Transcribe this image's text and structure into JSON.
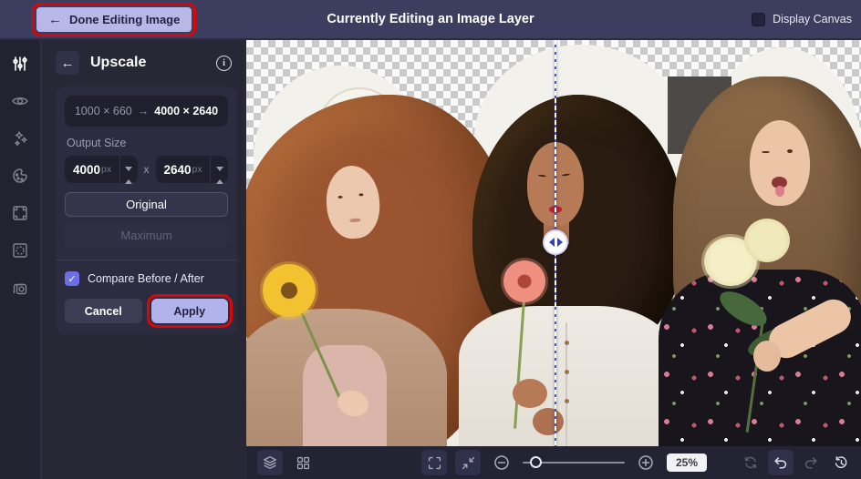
{
  "ui_colors": {
    "top_bar_bg": "#3d3d5f",
    "panel_bg": "#272736",
    "sidebar_bg": "#222231",
    "card_bg": "#2c2c40",
    "accent_lavender": "#b3b3ec",
    "checkbox_blue": "#6e6ee9",
    "annotation_red": "#dd0606",
    "zoom_pill_bg": "#f2f2f5"
  },
  "annotations": {
    "style": "red outline boxes",
    "highlighted_elements": [
      "done-editing-button",
      "apply-button"
    ]
  },
  "top_bar": {
    "back_arrow": "←",
    "done_button_label": "Done Editing Image",
    "title": "Currently Editing an Image Layer",
    "display_canvas_label": "Display Canvas",
    "display_canvas_checked": false
  },
  "sidebar": {
    "tools": [
      {
        "icon": "adjust-sliders-icon",
        "active": true
      },
      {
        "icon": "eye-icon",
        "active": false
      },
      {
        "icon": "magic-effects-icon",
        "active": false
      },
      {
        "icon": "color-palette-icon",
        "active": false
      },
      {
        "icon": "frame-icon",
        "active": false
      },
      {
        "icon": "mask-icon",
        "active": false
      },
      {
        "icon": "duplicate-layers-icon",
        "active": false
      }
    ]
  },
  "upscale_panel": {
    "back_arrow": "←",
    "title": "Upscale",
    "info_icon": "i",
    "dimension_before": "1000 × 660",
    "dimension_arrow": "→",
    "dimension_after": "4000 × 2640",
    "output_size_label": "Output Size",
    "width_value": "4000",
    "width_unit": "px",
    "size_separator": "x",
    "height_value": "2640",
    "height_unit": "px",
    "original_button_label": "Original",
    "maximum_button_label": "Maximum",
    "compare_checkbox": {
      "checked": true,
      "check_glyph": "✓",
      "label": "Compare Before / After"
    },
    "cancel_button_label": "Cancel",
    "apply_button_label": "Apply"
  },
  "canvas": {
    "content_description": "Three women holding flowers in front of white arches; background removed to transparency checkerboard at top; before/after upscale comparison divider down the middle",
    "divider": {
      "type": "before-after-drag-handle"
    },
    "zoom_level": "25%"
  },
  "toolbar_icons": [
    "layers-icon",
    "grid-view-icon",
    "fit-screen-icon",
    "collapse-view-icon",
    "zoom-out-icon",
    "zoom-slider",
    "zoom-in-icon",
    "refresh-icon",
    "undo-icon",
    "redo-icon",
    "history-icon"
  ]
}
